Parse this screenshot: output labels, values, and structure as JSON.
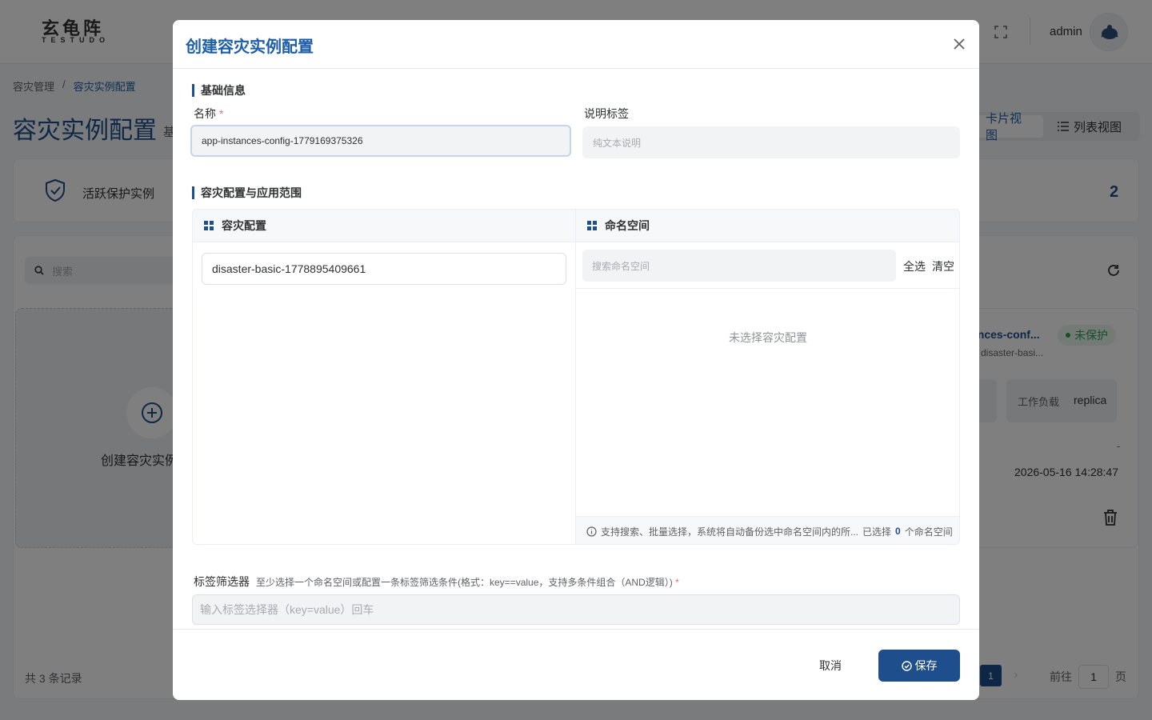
{
  "header": {
    "logo_cn": "玄龟阵",
    "logo_en": "TESTUDO",
    "username": "admin"
  },
  "breadcrumb": [
    "容灾管理",
    "容灾实例配置"
  ],
  "page": {
    "title": "容灾实例配置",
    "subtitle": "基"
  },
  "view_switch": {
    "card_label": "卡片视图",
    "list_label": "列表视图"
  },
  "stats": {
    "label": "活跃保护实例",
    "value": "2"
  },
  "list": {
    "search_placeholder": "搜索",
    "create_label": "创建容灾实例",
    "card": {
      "name": "ances-conf...",
      "sub": "disaster-basi...",
      "status": "未保护",
      "status_color": "#2e9e4f",
      "left_box_text": ".",
      "workload_label": "工作负载",
      "workload_value": "replica",
      "dash": "-",
      "time": "2026-05-16 14:28:47"
    },
    "total": "共 3 条记录",
    "current_page": "1",
    "goto_prefix": "前往",
    "goto_value": "1",
    "goto_suffix": "页"
  },
  "modal": {
    "title": "创建容灾实例配置",
    "section_basic": "基础信息",
    "name_label": "名称",
    "name_required": "*",
    "name_value": "app-instances-config-1779169375326",
    "desc_label": "说明标签",
    "desc_placeholder": "纯文本说明",
    "section_scope": "容灾配置与应用范围",
    "config_header": "容灾配置",
    "config_item": "disaster-basic-1778895409661",
    "namespace_header": "命名空间",
    "ns_search_placeholder": "搜索命名空间",
    "select_all": "全选",
    "clear": "清空",
    "ns_empty": "未选择容灾配置",
    "ns_foot_hint": "支持搜索、批量选择，系统将自动备份选中命名空间内的所...",
    "ns_selected_prefix": "已选择",
    "ns_selected_count": "0",
    "ns_selected_suffix": "个命名空间",
    "label_filter_title": "标签筛选器",
    "label_filter_hint": "至少选择一个命名空间或配置一条标签筛选条件(格式：key==value，支持多条件组合（AND逻辑）)",
    "label_filter_required": "*",
    "label_filter_placeholder": "输入标签选择器（key=value）回车",
    "cancel_label": "取消",
    "save_label": "保存"
  },
  "colors": {
    "primary": "#1e4f8c",
    "title_blue": "#1e5ea8",
    "required": "#f56c6c",
    "success": "#2e9e4f"
  }
}
